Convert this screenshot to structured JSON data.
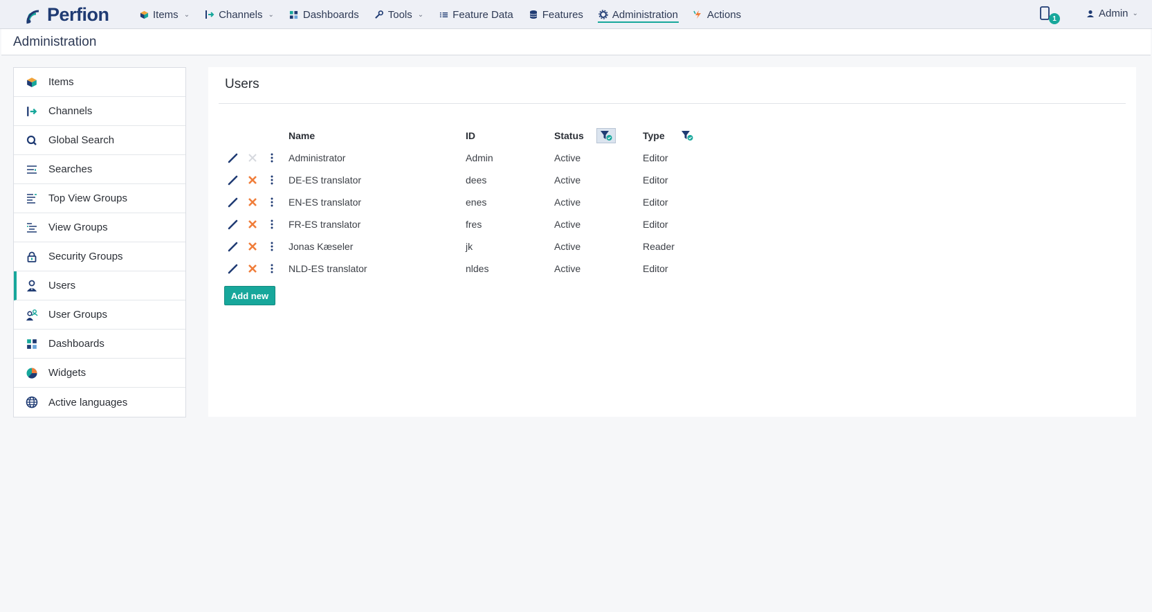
{
  "app": {
    "brand": "Perfion",
    "accent": "#17a79b",
    "navy": "#1f3b73"
  },
  "nav": {
    "items": [
      {
        "label": "Items",
        "icon": "cube-icon",
        "dropdown": true
      },
      {
        "label": "Channels",
        "icon": "channel-arrow-icon",
        "dropdown": true
      },
      {
        "label": "Dashboards",
        "icon": "dashboard-grid-icon",
        "dropdown": false
      },
      {
        "label": "Tools",
        "icon": "wrench-icon",
        "dropdown": true
      },
      {
        "label": "Feature Data",
        "icon": "list-icon",
        "dropdown": false
      },
      {
        "label": "Features",
        "icon": "database-icon",
        "dropdown": false
      },
      {
        "label": "Administration",
        "icon": "gear-icon",
        "dropdown": false,
        "active": true
      },
      {
        "label": "Actions",
        "icon": "lightning-icon",
        "dropdown": false
      }
    ],
    "notification_count": "1",
    "user_label": "Admin"
  },
  "page": {
    "title": "Administration"
  },
  "sidebar": {
    "items": [
      {
        "label": "Items",
        "icon": "cube-icon"
      },
      {
        "label": "Channels",
        "icon": "channel-arrow-icon"
      },
      {
        "label": "Global Search",
        "icon": "search-icon"
      },
      {
        "label": "Searches",
        "icon": "searches-list-icon"
      },
      {
        "label": "Top View Groups",
        "icon": "top-view-groups-icon"
      },
      {
        "label": "View Groups",
        "icon": "view-groups-icon"
      },
      {
        "label": "Security Groups",
        "icon": "lock-icon"
      },
      {
        "label": "Users",
        "icon": "user-icon",
        "active": true
      },
      {
        "label": "User Groups",
        "icon": "user-groups-icon"
      },
      {
        "label": "Dashboards",
        "icon": "dashboard-grid-icon"
      },
      {
        "label": "Widgets",
        "icon": "pie-icon"
      },
      {
        "label": "Active languages",
        "icon": "globe-icon"
      }
    ]
  },
  "users": {
    "title": "Users",
    "columns": {
      "name": "Name",
      "id": "ID",
      "status": "Status",
      "type": "Type"
    },
    "rows": [
      {
        "name": "Administrator",
        "id": "Admin",
        "status": "Active",
        "type": "Editor",
        "deletable": false
      },
      {
        "name": "DE-ES translator",
        "id": "dees",
        "status": "Active",
        "type": "Editor",
        "deletable": true
      },
      {
        "name": "EN-ES translator",
        "id": "enes",
        "status": "Active",
        "type": "Editor",
        "deletable": true
      },
      {
        "name": "FR-ES translator",
        "id": "fres",
        "status": "Active",
        "type": "Editor",
        "deletable": true
      },
      {
        "name": "Jonas Kæseler",
        "id": "jk",
        "status": "Active",
        "type": "Reader",
        "deletable": true
      },
      {
        "name": "NLD-ES translator",
        "id": "nldes",
        "status": "Active",
        "type": "Editor",
        "deletable": true
      }
    ],
    "add_label": "Add new"
  }
}
